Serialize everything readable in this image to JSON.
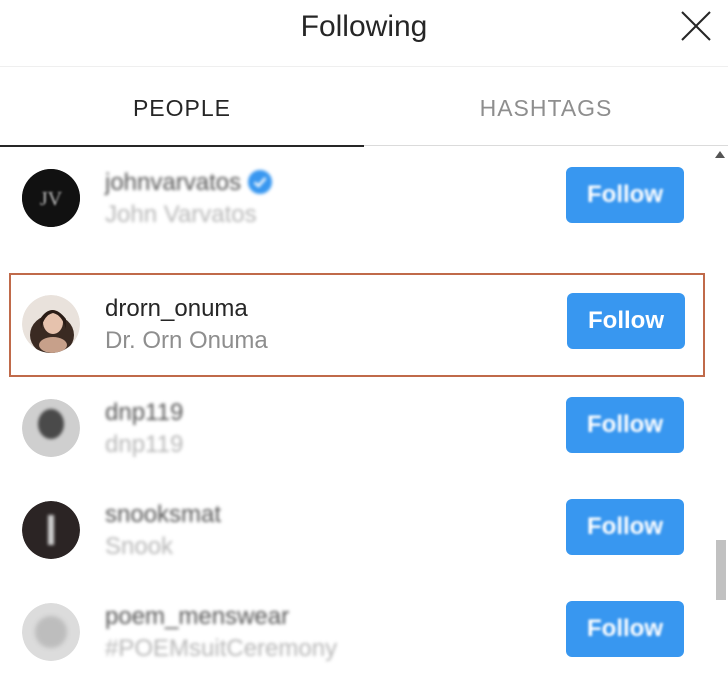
{
  "header": {
    "title": "Following"
  },
  "tabs": [
    {
      "label": "PEOPLE",
      "active": true
    },
    {
      "label": "HASHTAGS",
      "active": false
    }
  ],
  "accounts": [
    {
      "username": "johnvarvatos",
      "full_name": "John Varvatos",
      "verified": true,
      "button": "Follow",
      "avatar_color": "#111111"
    },
    {
      "username": "drorn_onuma",
      "full_name": "Dr. Orn Onuma",
      "verified": false,
      "button": "Follow",
      "selected": true,
      "avatar_color": "#8a6a5a"
    },
    {
      "username": "dnp119",
      "full_name": "dnp119",
      "verified": false,
      "button": "Follow",
      "avatar_color": "#9a9a9a"
    },
    {
      "username": "snooksmat",
      "full_name": "Snook",
      "verified": false,
      "button": "Follow",
      "avatar_color": "#3a3030"
    },
    {
      "username": "poem_menswear",
      "full_name": "#POEMsuitCeremony",
      "verified": false,
      "button": "Follow",
      "avatar_color": "#d8d8d8"
    }
  ],
  "colors": {
    "accent": "#3897f0",
    "selection_outline": "#c06a4a"
  }
}
